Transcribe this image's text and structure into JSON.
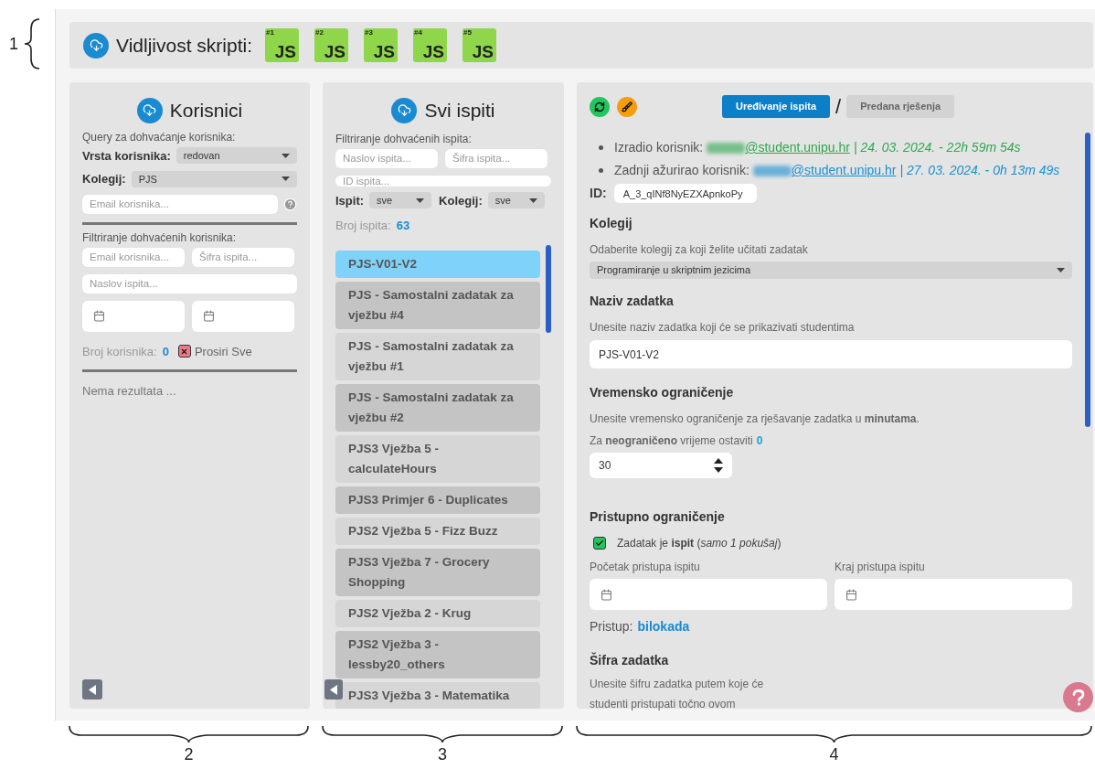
{
  "callouts": [
    "1",
    "2",
    "3",
    "4"
  ],
  "header": {
    "title": "Vidljivost skripti:",
    "scripts": [
      {
        "number": "#1",
        "label": "JS"
      },
      {
        "number": "#2",
        "label": "JS"
      },
      {
        "number": "#3",
        "label": "JS"
      },
      {
        "number": "#4",
        "label": "JS"
      },
      {
        "number": "#5",
        "label": "JS"
      }
    ]
  },
  "users_panel": {
    "title": "Korisnici",
    "query_label": "Query za dohvaćanje korisnika:",
    "user_type": {
      "label": "Vrsta korisnika:",
      "value": "redovan"
    },
    "course": {
      "label": "Kolegij:",
      "value": "PJS"
    },
    "email_placeholder": "Email korisnika...",
    "filter_label": "Filtriranje dohvaćenih korisnika:",
    "filter_email_placeholder": "Email korisnika...",
    "filter_code_placeholder": "Šifra ispita...",
    "filter_title_placeholder": "Naslov ispita...",
    "count_label": "Broj korisnika:",
    "count": "0",
    "expand": {
      "label": "Prosiri Sve"
    },
    "empty_text": "Nema rezultata ..."
  },
  "exams_panel": {
    "title": "Svi ispiti",
    "filter_label": "Filtriranje dohvaćenih ispita:",
    "title_placeholder": "Naslov ispita...",
    "code_placeholder": "Šifra ispita...",
    "id_placeholder": "ID ispita...",
    "exam_filter": {
      "label": "Ispit:",
      "value": "sve"
    },
    "course_filter": {
      "label": "Kolegij:",
      "value": "sve"
    },
    "count_label": "Broj ispita:",
    "count": "63",
    "items": [
      {
        "label": "PJS-V01-V2",
        "selected": true
      },
      {
        "label": "PJS - Samostalni zadatak za vježbu #4",
        "selected": false
      },
      {
        "label": "PJS - Samostalni zadatak za vježbu #1",
        "selected": false
      },
      {
        "label": "PJS - Samostalni zadatak za vježbu #2",
        "selected": false
      },
      {
        "label": "PJS3 Vježba 5 - calculateHours",
        "selected": false
      },
      {
        "label": "PJS3 Primjer 6 - Duplicates",
        "selected": false
      },
      {
        "label": "PJS2 Vježba 5 - Fizz Buzz",
        "selected": false
      },
      {
        "label": "PJS3 Vježba 7 - Grocery Shopping",
        "selected": false
      },
      {
        "label": "PJS2 Vježba 2 - Krug",
        "selected": false
      },
      {
        "label": "PJS2 Vježba 3 - lessby20_others",
        "selected": false
      },
      {
        "label": "PJS3 Vježba 3 - Matematika",
        "selected": false
      }
    ]
  },
  "editor": {
    "tabs": [
      {
        "label": "Uređivanje ispita",
        "selected": true
      },
      {
        "label": "Predana rješenja",
        "selected": false
      }
    ],
    "separator": "/",
    "history": [
      {
        "label": "Izradio korisnik:",
        "email": "@student.unipu.hr",
        "date": "| 24. 03. 2024. - 22h 59m 54s",
        "color": "#2fa84f"
      },
      {
        "label": "Zadnji ažurirao korisnik:",
        "email": "@student.unipu.hr",
        "date": "| 27. 03. 2024. - 0h 13m 49s",
        "color": "#1b8fd0"
      }
    ],
    "id_label": "ID:",
    "id_value": "A_3_qINf8NyEZXApnkoPy",
    "course_section": {
      "title": "Kolegij",
      "hint": "Odaberite kolegij za koji želite učitati zadatak",
      "value": "Programiranje u skriptnim jezicima"
    },
    "name_section": {
      "title": "Naziv zadatka",
      "hint": "Unesite naziv zadatka koji će se prikazivati studentima",
      "value": "PJS-V01-V2"
    },
    "time_section": {
      "title": "Vremensko ograničenje",
      "hint": "Unesite vremensko ograničenje za rješavanje zadatka u **minutama**.",
      "unlimited_hint": "Za **neograničeno** vrijeme ostaviti",
      "unlimited_value": "0",
      "value": "30"
    },
    "access_section": {
      "title": "Pristupno ograničenje",
      "exam_checkbox": {
        "label": "Zadatak je **ispit** (*samo 1 pokušaj*)",
        "checked": true
      },
      "start_label": "Početak pristupa ispitu",
      "end_label": "Kraj pristupa ispitu",
      "access_label": "Pristup:",
      "access_value": "bilokada"
    },
    "code_section": {
      "title": "Šifra zadatka",
      "hint": "Unesite šifru zadatka putem koje će studenti pristupati točno ovom"
    }
  }
}
